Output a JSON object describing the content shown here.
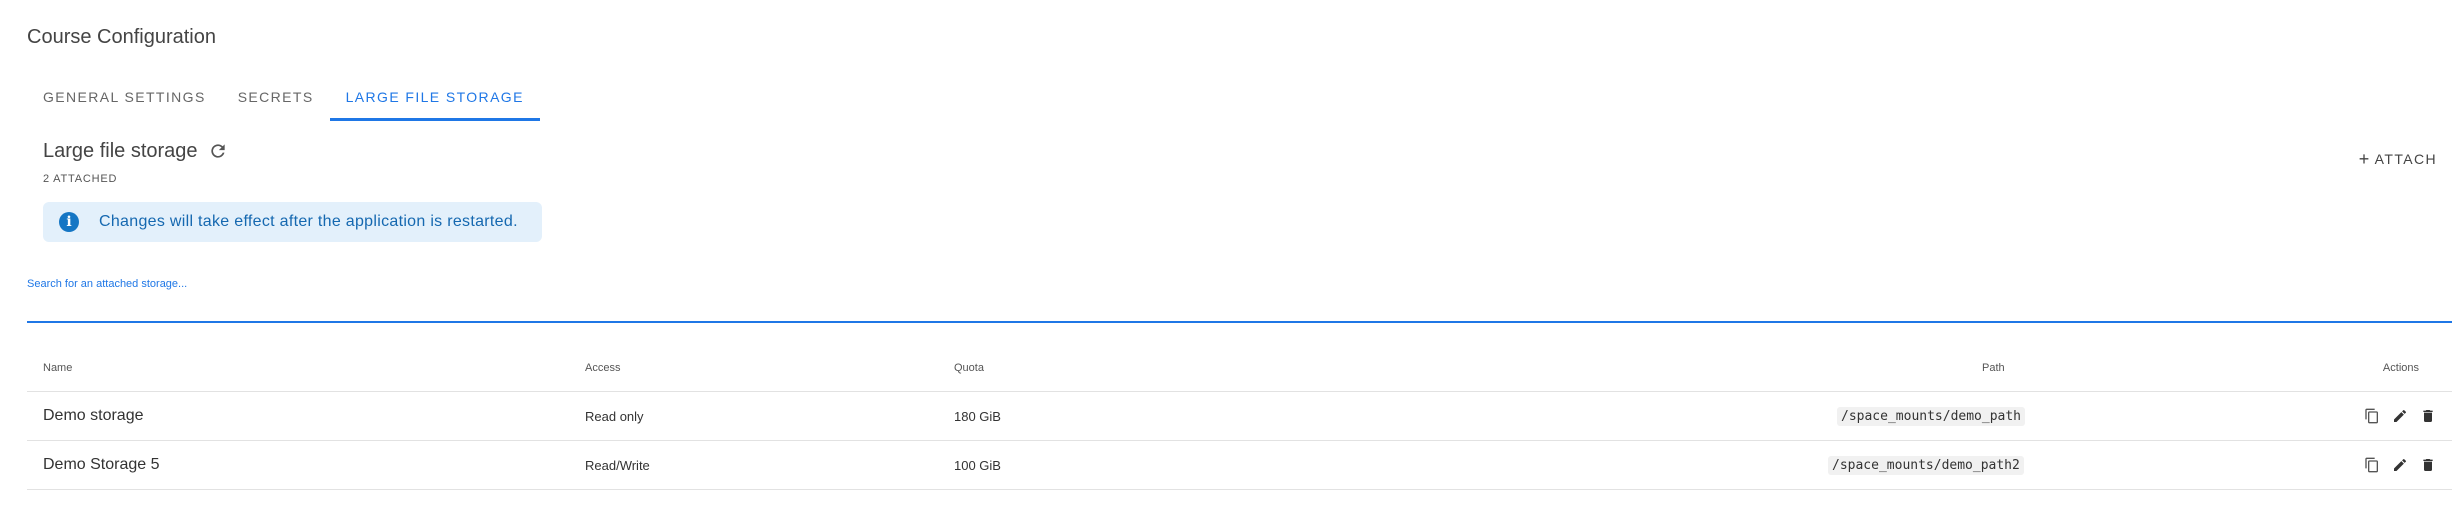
{
  "page": {
    "title": "Course Configuration"
  },
  "tabs": [
    {
      "label": "General Settings",
      "active": false
    },
    {
      "label": "Secrets",
      "active": false
    },
    {
      "label": "Large File Storage",
      "active": true
    }
  ],
  "section": {
    "title": "Large file storage",
    "attached_count": "2 attached",
    "attach_label": "Attach"
  },
  "banner": {
    "text": "Changes will take effect after the application is restarted.",
    "icon_glyph": "i"
  },
  "search": {
    "placeholder": "Search for an attached storage..."
  },
  "table": {
    "columns": [
      "Name",
      "Access",
      "Quota",
      "Path",
      "Actions"
    ],
    "rows": [
      {
        "name": "Demo storage",
        "access": "Read only",
        "quota": "180 GiB",
        "path": "/space_mounts/demo_path"
      },
      {
        "name": "Demo Storage 5",
        "access": "Read/Write",
        "quota": "100 GiB",
        "path": "/space_mounts/demo_path2"
      }
    ]
  },
  "colors": {
    "accent": "#1f77e6",
    "banner_bg": "#e3f0fb",
    "banner_text": "#1568b0"
  },
  "icons": {
    "refresh": "refresh-icon",
    "info": "info-icon",
    "copy": "copy-icon",
    "edit": "pencil-icon",
    "delete": "trash-icon"
  }
}
